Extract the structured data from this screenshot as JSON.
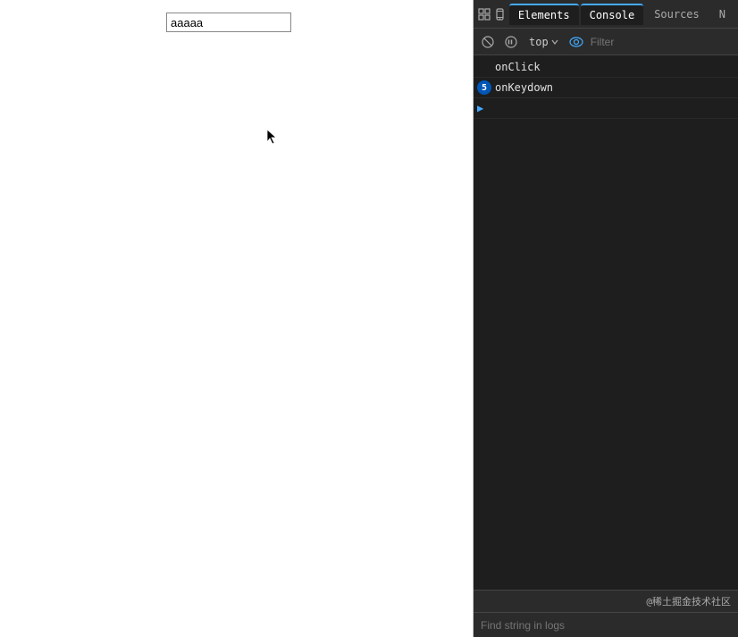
{
  "browser": {
    "input_value": "aaaaa"
  },
  "devtools": {
    "tabs": [
      {
        "id": "elements",
        "label": "Elements",
        "active": false
      },
      {
        "id": "console",
        "label": "Console",
        "active": true
      },
      {
        "id": "sources",
        "label": "Sources",
        "active": false
      },
      {
        "id": "network",
        "label": "N",
        "active": false
      }
    ],
    "toolbar": {
      "top_label": "top",
      "filter_placeholder": "Filter"
    },
    "console_entries": [
      {
        "id": "onclick",
        "type": "text",
        "text": "onClick",
        "has_badge": false
      },
      {
        "id": "onkeydown",
        "type": "badge",
        "text": "onKeydown",
        "badge_count": "5",
        "has_badge": true
      },
      {
        "id": "arrow",
        "type": "arrow",
        "text": "",
        "has_badge": false
      }
    ],
    "bottom": {
      "watermark": "@稀土掘金技术社区"
    },
    "find_bar": {
      "placeholder": "Find string in logs"
    }
  }
}
